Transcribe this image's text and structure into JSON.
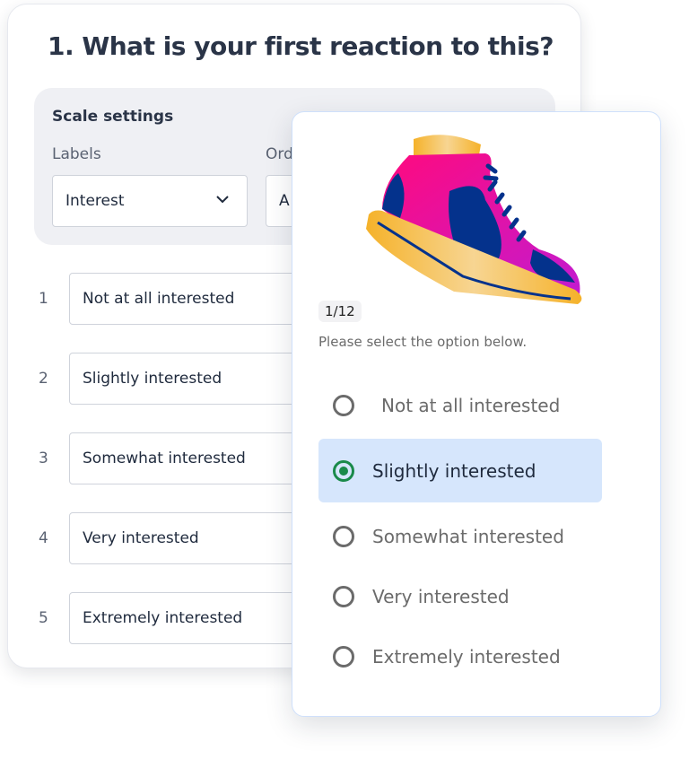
{
  "editor": {
    "question_title": "1. What is your first reaction to this?",
    "scale_settings": {
      "title": "Scale settings",
      "labels_label": "Labels",
      "labels_value": "Interest",
      "order_label": "Order",
      "order_value": "A"
    },
    "rows": [
      {
        "num": "1",
        "label": "Not at all interested"
      },
      {
        "num": "2",
        "label": "Slightly interested"
      },
      {
        "num": "3",
        "label": "Somewhat interested"
      },
      {
        "num": "4",
        "label": "Very interested"
      },
      {
        "num": "5",
        "label": "Extremely interested"
      }
    ]
  },
  "preview": {
    "image": "sneaker-illustration",
    "counter": "1/12",
    "prompt": "Please select the option below.",
    "selected_index": 1,
    "accent_color": "#1a8a4a",
    "options": [
      "Not at all interested",
      "Slightly interested",
      "Somewhat interested",
      "Very interested",
      "Extremely interested"
    ]
  }
}
